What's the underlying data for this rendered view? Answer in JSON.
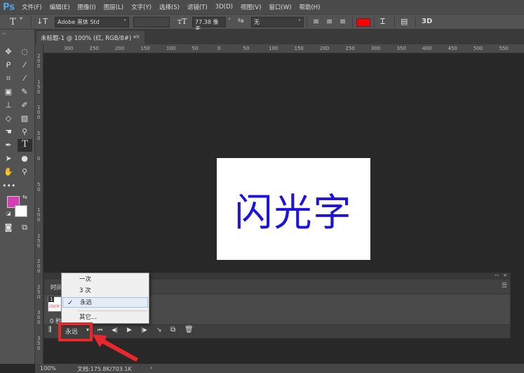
{
  "app": {
    "logo": "Ps"
  },
  "menubar": [
    "文件(F)",
    "编辑(E)",
    "图像(I)",
    "图层(L)",
    "文字(Y)",
    "选择(S)",
    "滤镜(T)",
    "3D(D)",
    "视图(V)",
    "窗口(W)",
    "帮助(H)"
  ],
  "options": {
    "font_family": "Adobe 黑体 Std",
    "font_style": "",
    "font_size": "77.38 像素",
    "antialias": "无",
    "text_color": "#ff0000",
    "three_d": "3D"
  },
  "document": {
    "tab_title": "未标题-1 @ 100% (红, RGB/8#) *",
    "text": "闪光字",
    "text_color": "#1d12de"
  },
  "ruler": {
    "h_labels": [
      "300",
      "250",
      "200",
      "150",
      "100",
      "50",
      "0",
      "50",
      "100",
      "150",
      "200",
      "250",
      "300",
      "350",
      "400",
      "450",
      "500",
      "550"
    ],
    "v_labels": [
      "200",
      "150",
      "100",
      "50",
      "0",
      "50",
      "100",
      "150",
      "200",
      "250",
      "300",
      "350"
    ]
  },
  "colors": {
    "foreground": "#d63fb4",
    "background": "#ffffff"
  },
  "timeline": {
    "tab": "时间轴",
    "frame_number": "1",
    "frame_label": "闪光字",
    "frame_delay": "0 秒",
    "loop_value": "永远"
  },
  "loop_menu": {
    "items": [
      "一次",
      "3 次",
      "永远",
      "其它..."
    ],
    "selected": "永远"
  },
  "status": {
    "zoom": "100%",
    "doc_info": "文档:175.8K/703.1K"
  }
}
